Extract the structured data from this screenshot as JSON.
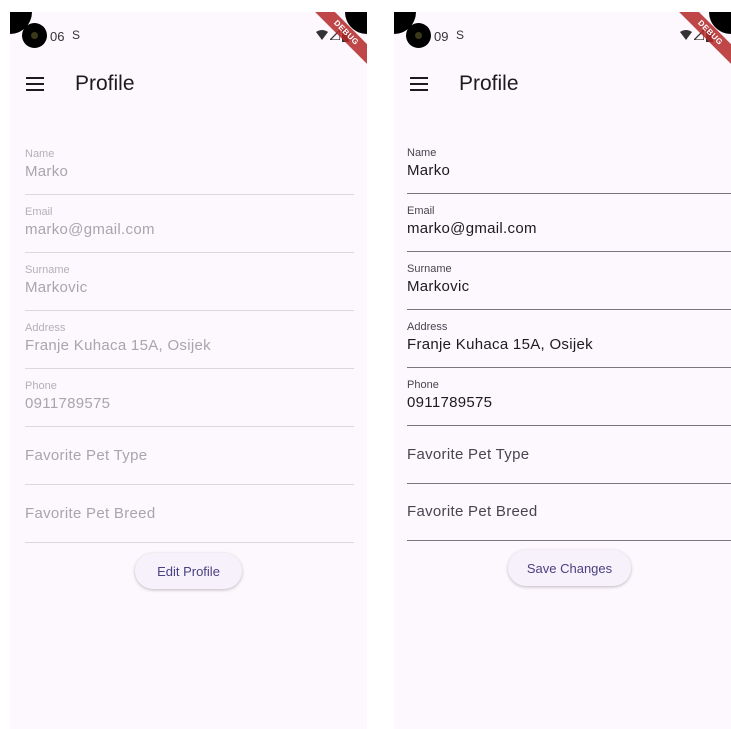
{
  "screens": [
    {
      "status_time": "06",
      "status_sim": "S",
      "debug_label": "DEBUG",
      "title": "Profile",
      "fields": [
        {
          "label": "Name",
          "value": "Marko"
        },
        {
          "label": "Email",
          "value": "marko@gmail.com"
        },
        {
          "label": "Surname",
          "value": "Markovic"
        },
        {
          "label": "Address",
          "value": "Franje Kuhaca 15A, Osijek"
        },
        {
          "label": "Phone",
          "value": "0911789575"
        }
      ],
      "placeholders": [
        "Favorite Pet Type",
        "Favorite Pet Breed"
      ],
      "button_label": "Edit Profile",
      "mode": "read-only"
    },
    {
      "status_time": "09",
      "status_sim": "S",
      "debug_label": "DEBUG",
      "title": "Profile",
      "fields": [
        {
          "label": "Name",
          "value": "Marko"
        },
        {
          "label": "Email",
          "value": "marko@gmail.com"
        },
        {
          "label": "Surname",
          "value": "Markovic"
        },
        {
          "label": "Address",
          "value": "Franje Kuhaca 15A, Osijek"
        },
        {
          "label": "Phone",
          "value": "0911789575"
        }
      ],
      "placeholders": [
        "Favorite Pet Type",
        "Favorite Pet Breed"
      ],
      "button_label": "Save Changes",
      "mode": "editable"
    }
  ],
  "icons": {
    "menu": "menu-icon",
    "wifi": "wifi-icon",
    "signal": "signal-icon",
    "battery": "battery-icon",
    "camera": "camera-icon"
  },
  "colors": {
    "background": "#fdf7fe",
    "button_text": "#4a4180",
    "debug_banner": "#b42828"
  }
}
